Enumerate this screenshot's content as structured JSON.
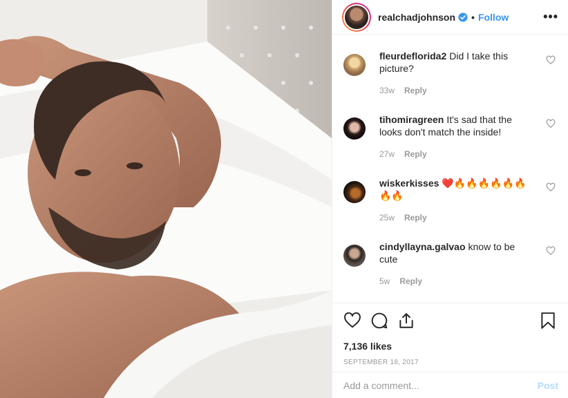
{
  "header": {
    "username": "realchadjohnson",
    "verified_icon": "verified-badge-icon",
    "separator": "•",
    "follow_label": "Follow",
    "more_label": "•••"
  },
  "comments": [
    {
      "user": "fleurdeflorida2",
      "text": "Did I take this picture?",
      "age": "33w",
      "reply": "Reply"
    },
    {
      "user": "tihomiragreen",
      "text": "It's sad that the looks don't match the inside!",
      "age": "27w",
      "reply": "Reply"
    },
    {
      "user": "wiskerkisses",
      "text": "❤️🔥🔥🔥🔥🔥🔥🔥🔥",
      "age": "25w",
      "reply": "Reply"
    },
    {
      "user": "cindyllayna.galvao",
      "text": "know to be cute",
      "age": "5w",
      "reply": "Reply"
    }
  ],
  "actions": {
    "likes": "7,136 likes",
    "date": "SEPTEMBER 18, 2017"
  },
  "add_comment": {
    "placeholder": "Add a comment...",
    "post_label": "Post"
  },
  "colors": {
    "accent": "#3897f0",
    "post_disabled": "#b3dbff",
    "muted": "#999999",
    "text": "#262626"
  }
}
